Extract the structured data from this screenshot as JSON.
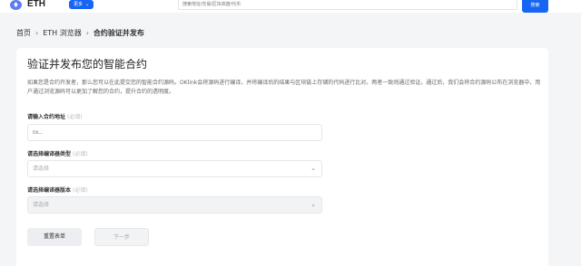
{
  "header": {
    "logo_icon": "ethereum-icon",
    "title": "ETH",
    "more_label": "更多",
    "search_placeholder": "搜索地址/交易/区块高度/代币",
    "search_button": "搜索"
  },
  "breadcrumb": {
    "home": "首页",
    "explorer": "ETH 浏览器",
    "current": "合约验证并发布"
  },
  "card": {
    "title": "验证并发布您的智能合约",
    "description": "如果您是合约开发者，那么您可以在此提交您的智能合约源码。OKlink会将源码进行编译，并将编译后的结果与区块链上存储的代码进行比对。两者一致则通过验证。通过后，我们会将合约源码公布在浏览器中，用户通过浏览源码可以更加了解您的合约，提升合约的透明度。",
    "address_label": "请输入合约地址",
    "address_required": "(必填)",
    "address_placeholder": "0x...",
    "compiler_type_label": "请选择编译器类型",
    "compiler_type_required": "(必填)",
    "compiler_type_value": "请选择",
    "compiler_version_label": "请选择编译器版本",
    "compiler_version_required": "(必填)",
    "compiler_version_value": "请选择",
    "reset_button": "重置表单",
    "next_button": "下一步"
  }
}
